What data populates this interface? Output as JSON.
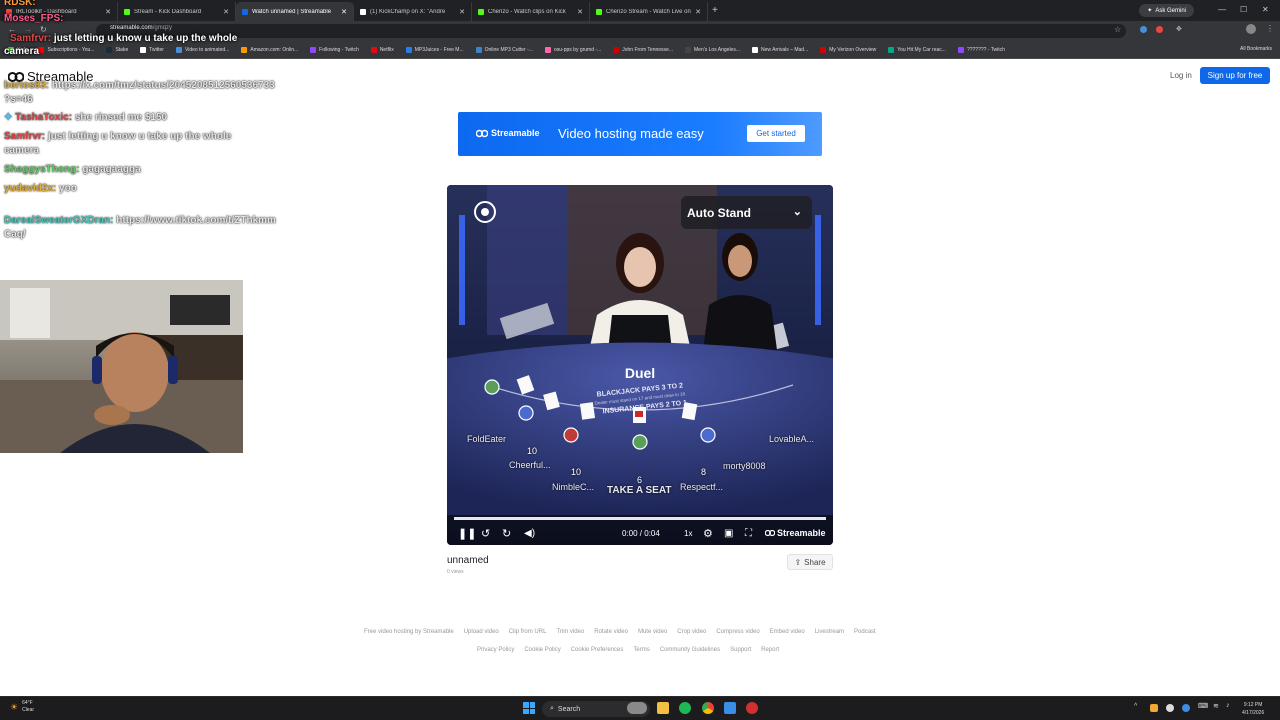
{
  "browser": {
    "tabs": [
      {
        "title": "IRLToolkit - Dashboard",
        "color": "#e8483e",
        "active": false
      },
      {
        "title": "Stream - Kick Dashboard",
        "color": "#53fc18",
        "active": false
      },
      {
        "title": "Watch unnamed | Streamable",
        "color": "#0f68e8",
        "active": true
      },
      {
        "title": "(1) KickChamp on X: \"Andre",
        "color": "#ffffff",
        "active": false
      },
      {
        "title": "Chenzo - Watch clips on Kick",
        "color": "#53fc18",
        "active": false
      },
      {
        "title": "Chenzo Stream - Watch Live on",
        "color": "#53fc18",
        "active": false
      }
    ],
    "new_tab": "+",
    "ask_gemini": "Ask Gemini",
    "url_host": "streamable.com",
    "url_path": "/gmqzy",
    "bookmarks": [
      {
        "label": "Kick",
        "color": "#53fc18"
      },
      {
        "label": "Subscriptions - You...",
        "color": "#ff0000"
      },
      {
        "label": "Stake",
        "color": "#1a2c38"
      },
      {
        "label": "Twitter",
        "color": "#ffffff"
      },
      {
        "label": "Video to animated...",
        "color": "#4a90d9"
      },
      {
        "label": "Amazon.com: Onlin...",
        "color": "#ff9900"
      },
      {
        "label": "Following - Twitch",
        "color": "#9146ff"
      },
      {
        "label": "Netflix",
        "color": "#e50914"
      },
      {
        "label": "MP3Juices - Free M...",
        "color": "#2b7de9"
      },
      {
        "label": "Online MP3 Cutter -...",
        "color": "#3d85c6"
      },
      {
        "label": "osu-pps by grumd -...",
        "color": "#ff66aa"
      },
      {
        "label": "John From Tennesse...",
        "color": "#cc0000"
      },
      {
        "label": "Men's Los Angeles...",
        "color": "#444444"
      },
      {
        "label": "New Arrivals – Mad...",
        "color": "#ffffff"
      },
      {
        "label": "My Verizon Overview",
        "color": "#cd040b"
      },
      {
        "label": "You Hit My Car reac...",
        "color": "#00a884"
      },
      {
        "label": "??????? - Twitch",
        "color": "#9146ff"
      }
    ],
    "all_bookmarks": "All Bookmarks"
  },
  "overlay": {
    "top_label_1": "RDSK:",
    "top_label_2": "Moses_FPS:",
    "banner_user": "Samfrvr:",
    "banner_text": "just letting u know u take up the whole",
    "banner_text_2": "camera",
    "chat": [
      {
        "user": "bertos83:",
        "text": "https://x.com/tmz/status/2045208512560536733",
        "cont": "?s=46",
        "color": "#e0b040"
      },
      {
        "user": "TashaToxic:",
        "text": "she rinsed me $150",
        "color": "#e04848"
      },
      {
        "user": "Samfrvr:",
        "text": "just letting u know u take up the whole",
        "cont": "camera",
        "color": "#e04848"
      },
      {
        "user": "ShaggysThong:",
        "text": "gagagaagga",
        "color": "#5fd35f"
      },
      {
        "user": "yudavid2x:",
        "text": "yoo",
        "color": "#e0b040"
      },
      {
        "user": "DarealSweaterGXDran:",
        "text": "https://www.tiktok.com/t/ZThkmm",
        "cont": "Caq/",
        "color": "#4fc3b8"
      }
    ]
  },
  "page": {
    "logo": "Streamable",
    "login": "Log in",
    "signup": "Sign up for free",
    "ad": {
      "logo": "Streamable",
      "headline": "Video hosting made easy",
      "cta": "Get started"
    },
    "player": {
      "auto_stand": "Auto Stand",
      "table_title": "Duel",
      "table_line_1": "BLACKJACK PAYS 3 TO 2",
      "table_line_2": "Dealer must stand on 17 and must draw to 16",
      "table_line_3": "INSURANCE PAYS 2 TO 1",
      "seats": [
        {
          "name": "FoldEater"
        },
        {
          "name": "Cheerful..."
        },
        {
          "name": "NimbleC..."
        },
        {
          "name": "TAKE A SEAT"
        },
        {
          "name": "Respectf..."
        },
        {
          "name": "morty8008"
        },
        {
          "name": "LovableA..."
        }
      ],
      "counts": [
        "10",
        "10",
        "6",
        "8"
      ],
      "time": "0:00 / 0:04",
      "speed": "1x",
      "brand": "Streamable",
      "progress_fraction": 0.0
    },
    "video_title": "unnamed",
    "views": "0 views",
    "share": "Share",
    "footer_links_1": [
      "Free video hosting by Streamable",
      "Upload video",
      "Clip from URL",
      "Trim video",
      "Rotate video",
      "Mute video",
      "Crop video",
      "Compress video",
      "Embed video",
      "Livestream",
      "Podcast"
    ],
    "footer_links_2": [
      "Privacy Policy",
      "Cookie Policy",
      "Cookie Preferences",
      "Terms",
      "Community Guidelines",
      "Support",
      "Report"
    ]
  },
  "taskbar": {
    "temp": "64°F",
    "weather": "Clear",
    "search": "Search",
    "time": "9:12 PM",
    "date": "4/17/2026"
  }
}
